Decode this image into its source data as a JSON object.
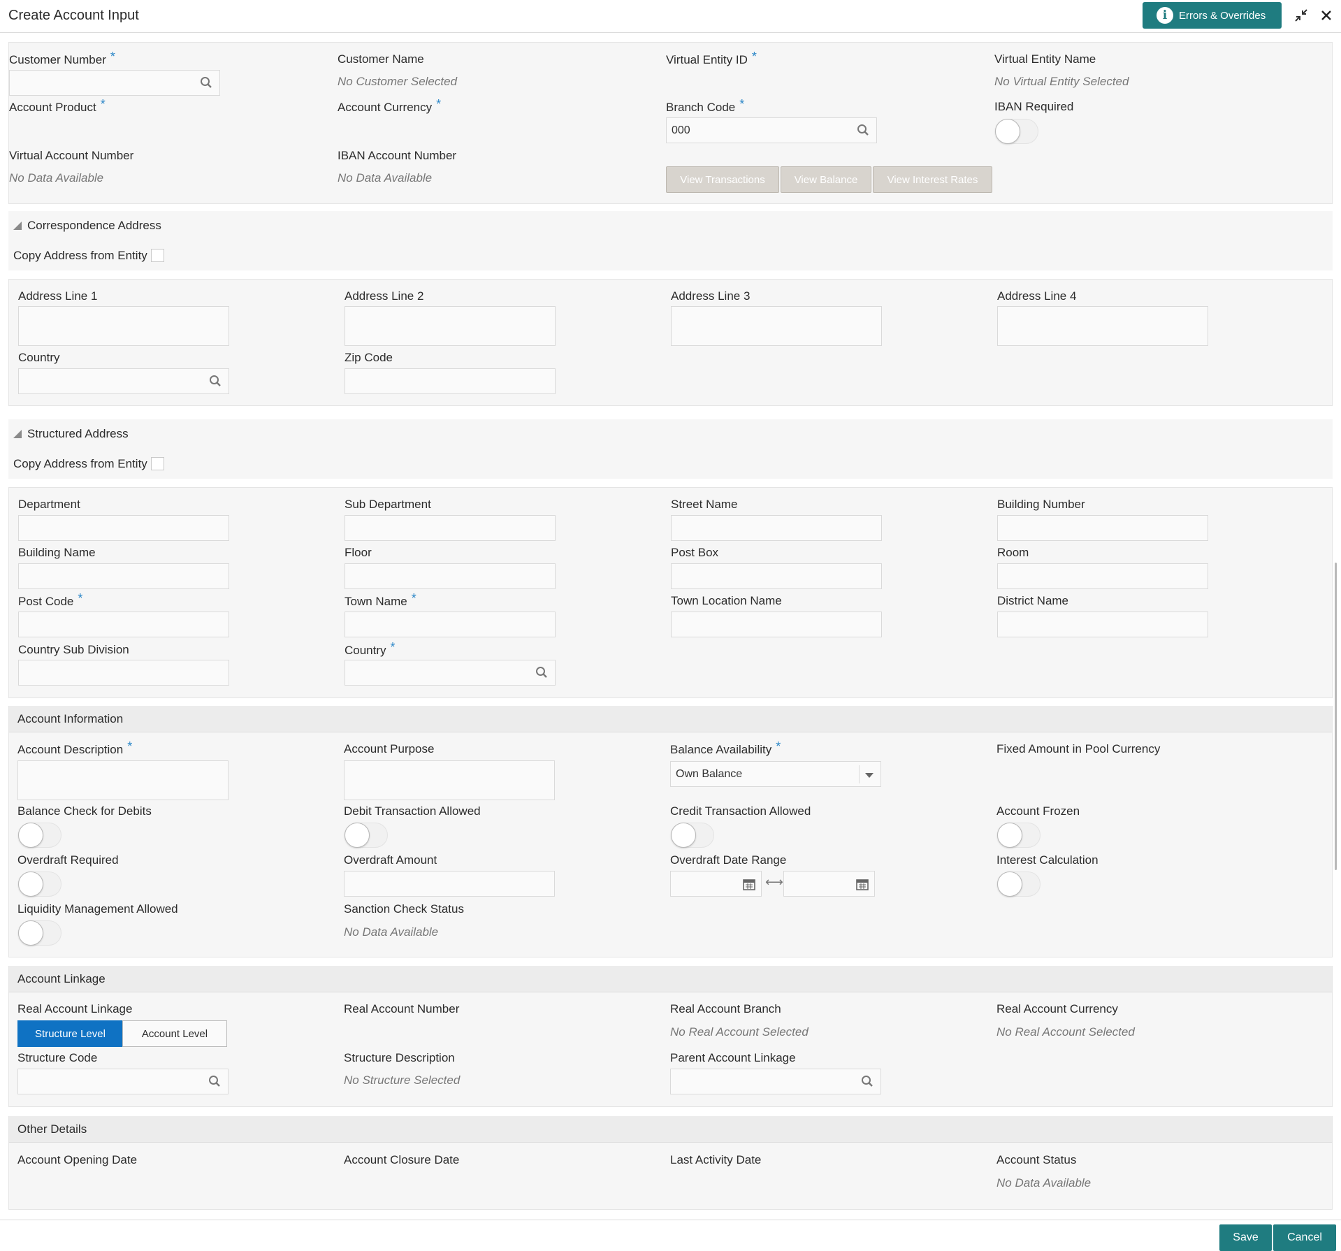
{
  "header": {
    "title": "Create Account Input",
    "errors_label": "Errors & Overrides"
  },
  "top": {
    "customer_number": "Customer Number",
    "customer_name": "Customer Name",
    "customer_name_value": "No Customer Selected",
    "virtual_entity_id": "Virtual Entity ID",
    "virtual_entity_name": "Virtual Entity Name",
    "virtual_entity_name_value": "No Virtual Entity Selected",
    "account_product": "Account Product",
    "account_currency": "Account Currency",
    "branch_code": "Branch Code",
    "branch_code_value": "000",
    "iban_required": "IBAN Required",
    "virtual_account_number": "Virtual Account Number",
    "virtual_account_number_value": "No Data Available",
    "iban_account_number": "IBAN Account Number",
    "iban_account_number_value": "No Data Available",
    "view_transactions": "View Transactions",
    "view_balance": "View Balance",
    "view_interest_rates": "View Interest Rates",
    "required_mark": "*"
  },
  "correspondence": {
    "title": "Correspondence Address",
    "copy_label": "Copy Address from Entity",
    "address_line_1": "Address Line 1",
    "address_line_2": "Address Line 2",
    "address_line_3": "Address Line 3",
    "address_line_4": "Address Line 4",
    "country": "Country",
    "zip_code": "Zip Code"
  },
  "structured": {
    "title": "Structured Address",
    "copy_label": "Copy Address from Entity",
    "department": "Department",
    "sub_department": "Sub Department",
    "street_name": "Street Name",
    "building_number": "Building Number",
    "building_name": "Building Name",
    "floor": "Floor",
    "post_box": "Post Box",
    "room": "Room",
    "post_code": "Post Code",
    "town_name": "Town Name",
    "town_location_name": "Town Location Name",
    "district_name": "District Name",
    "country_sub_division": "Country Sub Division",
    "country": "Country"
  },
  "account_info": {
    "title": "Account Information",
    "account_description": "Account Description",
    "account_purpose": "Account Purpose",
    "balance_availability": "Balance Availability",
    "balance_availability_value": "Own Balance",
    "fixed_amount": "Fixed Amount in Pool Currency",
    "balance_check": "Balance Check for Debits",
    "debit_allowed": "Debit Transaction Allowed",
    "credit_allowed": "Credit Transaction Allowed",
    "account_frozen": "Account Frozen",
    "overdraft_required": "Overdraft Required",
    "overdraft_amount": "Overdraft Amount",
    "overdraft_date_range": "Overdraft Date Range",
    "interest_calculation": "Interest Calculation",
    "liquidity_allowed": "Liquidity Management Allowed",
    "sanction_status": "Sanction Check Status",
    "sanction_status_value": "No Data Available"
  },
  "linkage": {
    "title": "Account Linkage",
    "real_account_linkage": "Real Account Linkage",
    "structure_level": "Structure Level",
    "account_level": "Account Level",
    "real_account_number": "Real Account Number",
    "real_account_branch": "Real Account Branch",
    "real_account_branch_value": "No Real Account Selected",
    "real_account_currency": "Real Account Currency",
    "real_account_currency_value": "No Real Account Selected",
    "structure_code": "Structure Code",
    "structure_description": "Structure Description",
    "structure_description_value": "No Structure Selected",
    "parent_account_linkage": "Parent Account Linkage"
  },
  "other": {
    "title": "Other Details",
    "opening_date": "Account Opening Date",
    "closure_date": "Account Closure Date",
    "last_activity_date": "Last Activity Date",
    "account_status": "Account Status",
    "account_status_value": "No Data Available"
  },
  "footer": {
    "save": "Save",
    "cancel": "Cancel"
  },
  "colors": {
    "primary_teal": "#1f7c80",
    "segment_active": "#0f72c3",
    "required_star": "#2a86c7"
  }
}
